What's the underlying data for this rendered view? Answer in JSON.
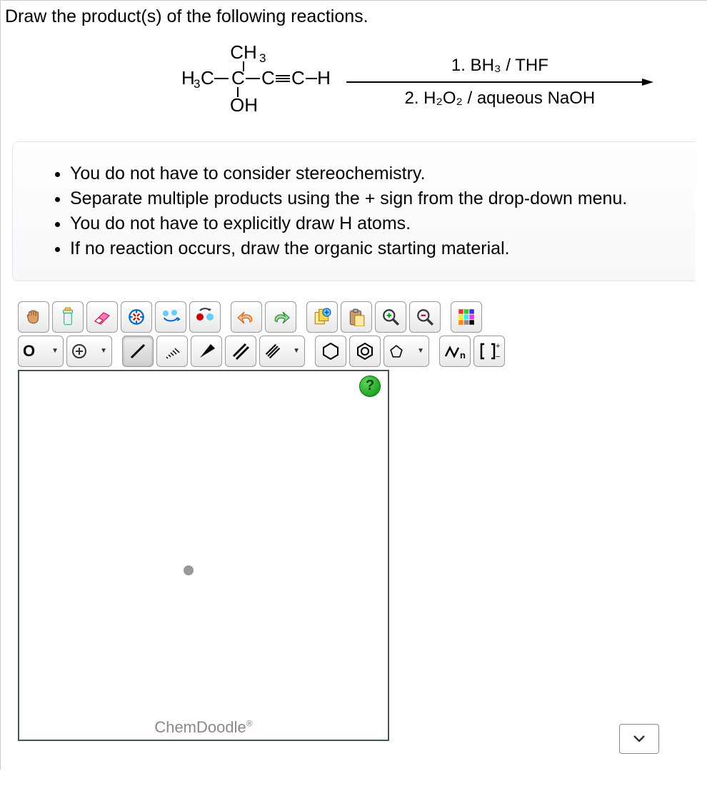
{
  "prompt": "Draw the product(s) of the following reactions.",
  "reaction": {
    "reagent1": "1. BH₃ / THF",
    "reagent2": "2. H₂O₂ / aqueous NaOH"
  },
  "hints": [
    "You do not have to consider stereochemistry.",
    "Separate multiple products using the + sign from the drop-down menu.",
    "You do not have to explicitly draw H atoms.",
    "If no reaction occurs, draw the organic starting material."
  ],
  "secondbar": {
    "element": "O",
    "sn": "n"
  },
  "help": "?",
  "brand": "ChemDoodle"
}
